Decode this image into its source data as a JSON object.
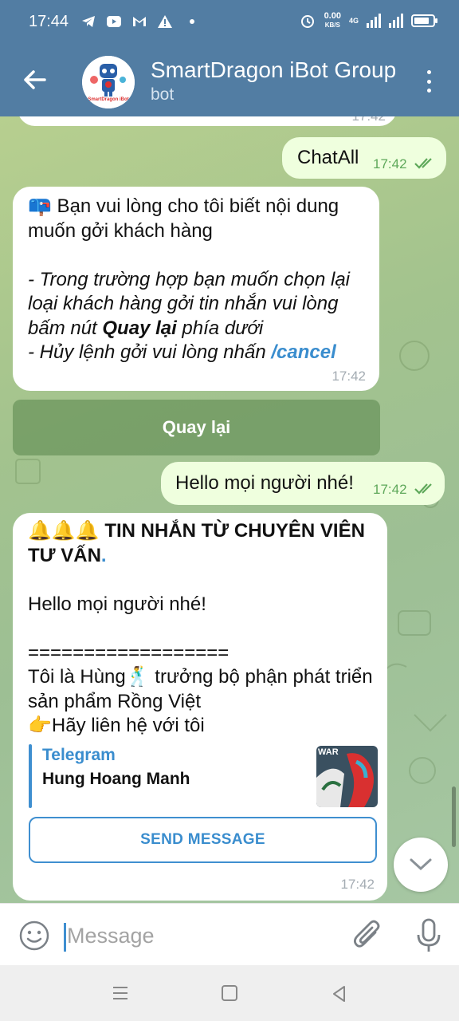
{
  "status_bar": {
    "time": "17:44",
    "net_speed_value": "0.00",
    "net_speed_unit": "KB/S",
    "network": "4G",
    "left_icons": [
      "telegram-icon",
      "youtube-icon",
      "gmail-icon",
      "warning-icon",
      "dot-icon"
    ],
    "right_icons": [
      "alarm-icon",
      "signal-icon",
      "signal-icon",
      "battery-icon"
    ],
    "battery_level": 0.8
  },
  "header": {
    "title": "SmartDragon iBot Group",
    "subtitle": "bot",
    "avatar_text": "SmartDragon iBot",
    "colors": {
      "bar": "#527da3"
    }
  },
  "messages": [
    {
      "type": "outgoing",
      "text": "ChatAll",
      "time": "17:42",
      "status": "read"
    },
    {
      "type": "incoming",
      "emoji": "📪",
      "line1": " Bạn vui lòng cho tôi biết nội dung muốn gởi khách hàng",
      "line2_a": "- Trong trường hợp bạn muốn chọn lại loại khách hàng gởi tin nhắn vui lòng bấm nút ",
      "line2_bold": "Quay lại",
      "line2_b": " phía dưới",
      "line3_a": "- Hủy lệnh gởi vui lòng nhấn ",
      "line3_cmd": "/cancel",
      "time": "17:42"
    },
    {
      "type": "keyboard_button",
      "label": "Quay lại"
    },
    {
      "type": "outgoing",
      "text": "Hello mọi người nhé!",
      "time": "17:42",
      "status": "read"
    },
    {
      "type": "incoming",
      "emoji": "🔔🔔🔔",
      "heading": " TIN NHẮN TỪ CHUYÊN VIÊN TƯ VẤN",
      "heading_dot": ".",
      "greeting": "Hello mọi người nhé!",
      "divider": "==================",
      "intro_a": "Tôi là Hùng",
      "intro_emoji": "🕺",
      "intro_b": " trưởng bộ phận phát triển sản  phẩm Rồng Việt",
      "contact_emoji": "👉",
      "contact": "Hãy liên hệ với tôi",
      "preview_site": "Telegram",
      "preview_title": "Hung Hoang Manh",
      "preview_thumb_text": "WAR",
      "button": "SEND MESSAGE",
      "time": "17:42"
    }
  ],
  "input": {
    "placeholder": "Message",
    "value": ""
  },
  "colors": {
    "accent": "#3f8fd0",
    "outgoing_bubble": "#efffde",
    "incoming_bubble": "#ffffff",
    "read_ticks": "#5ea85a"
  }
}
